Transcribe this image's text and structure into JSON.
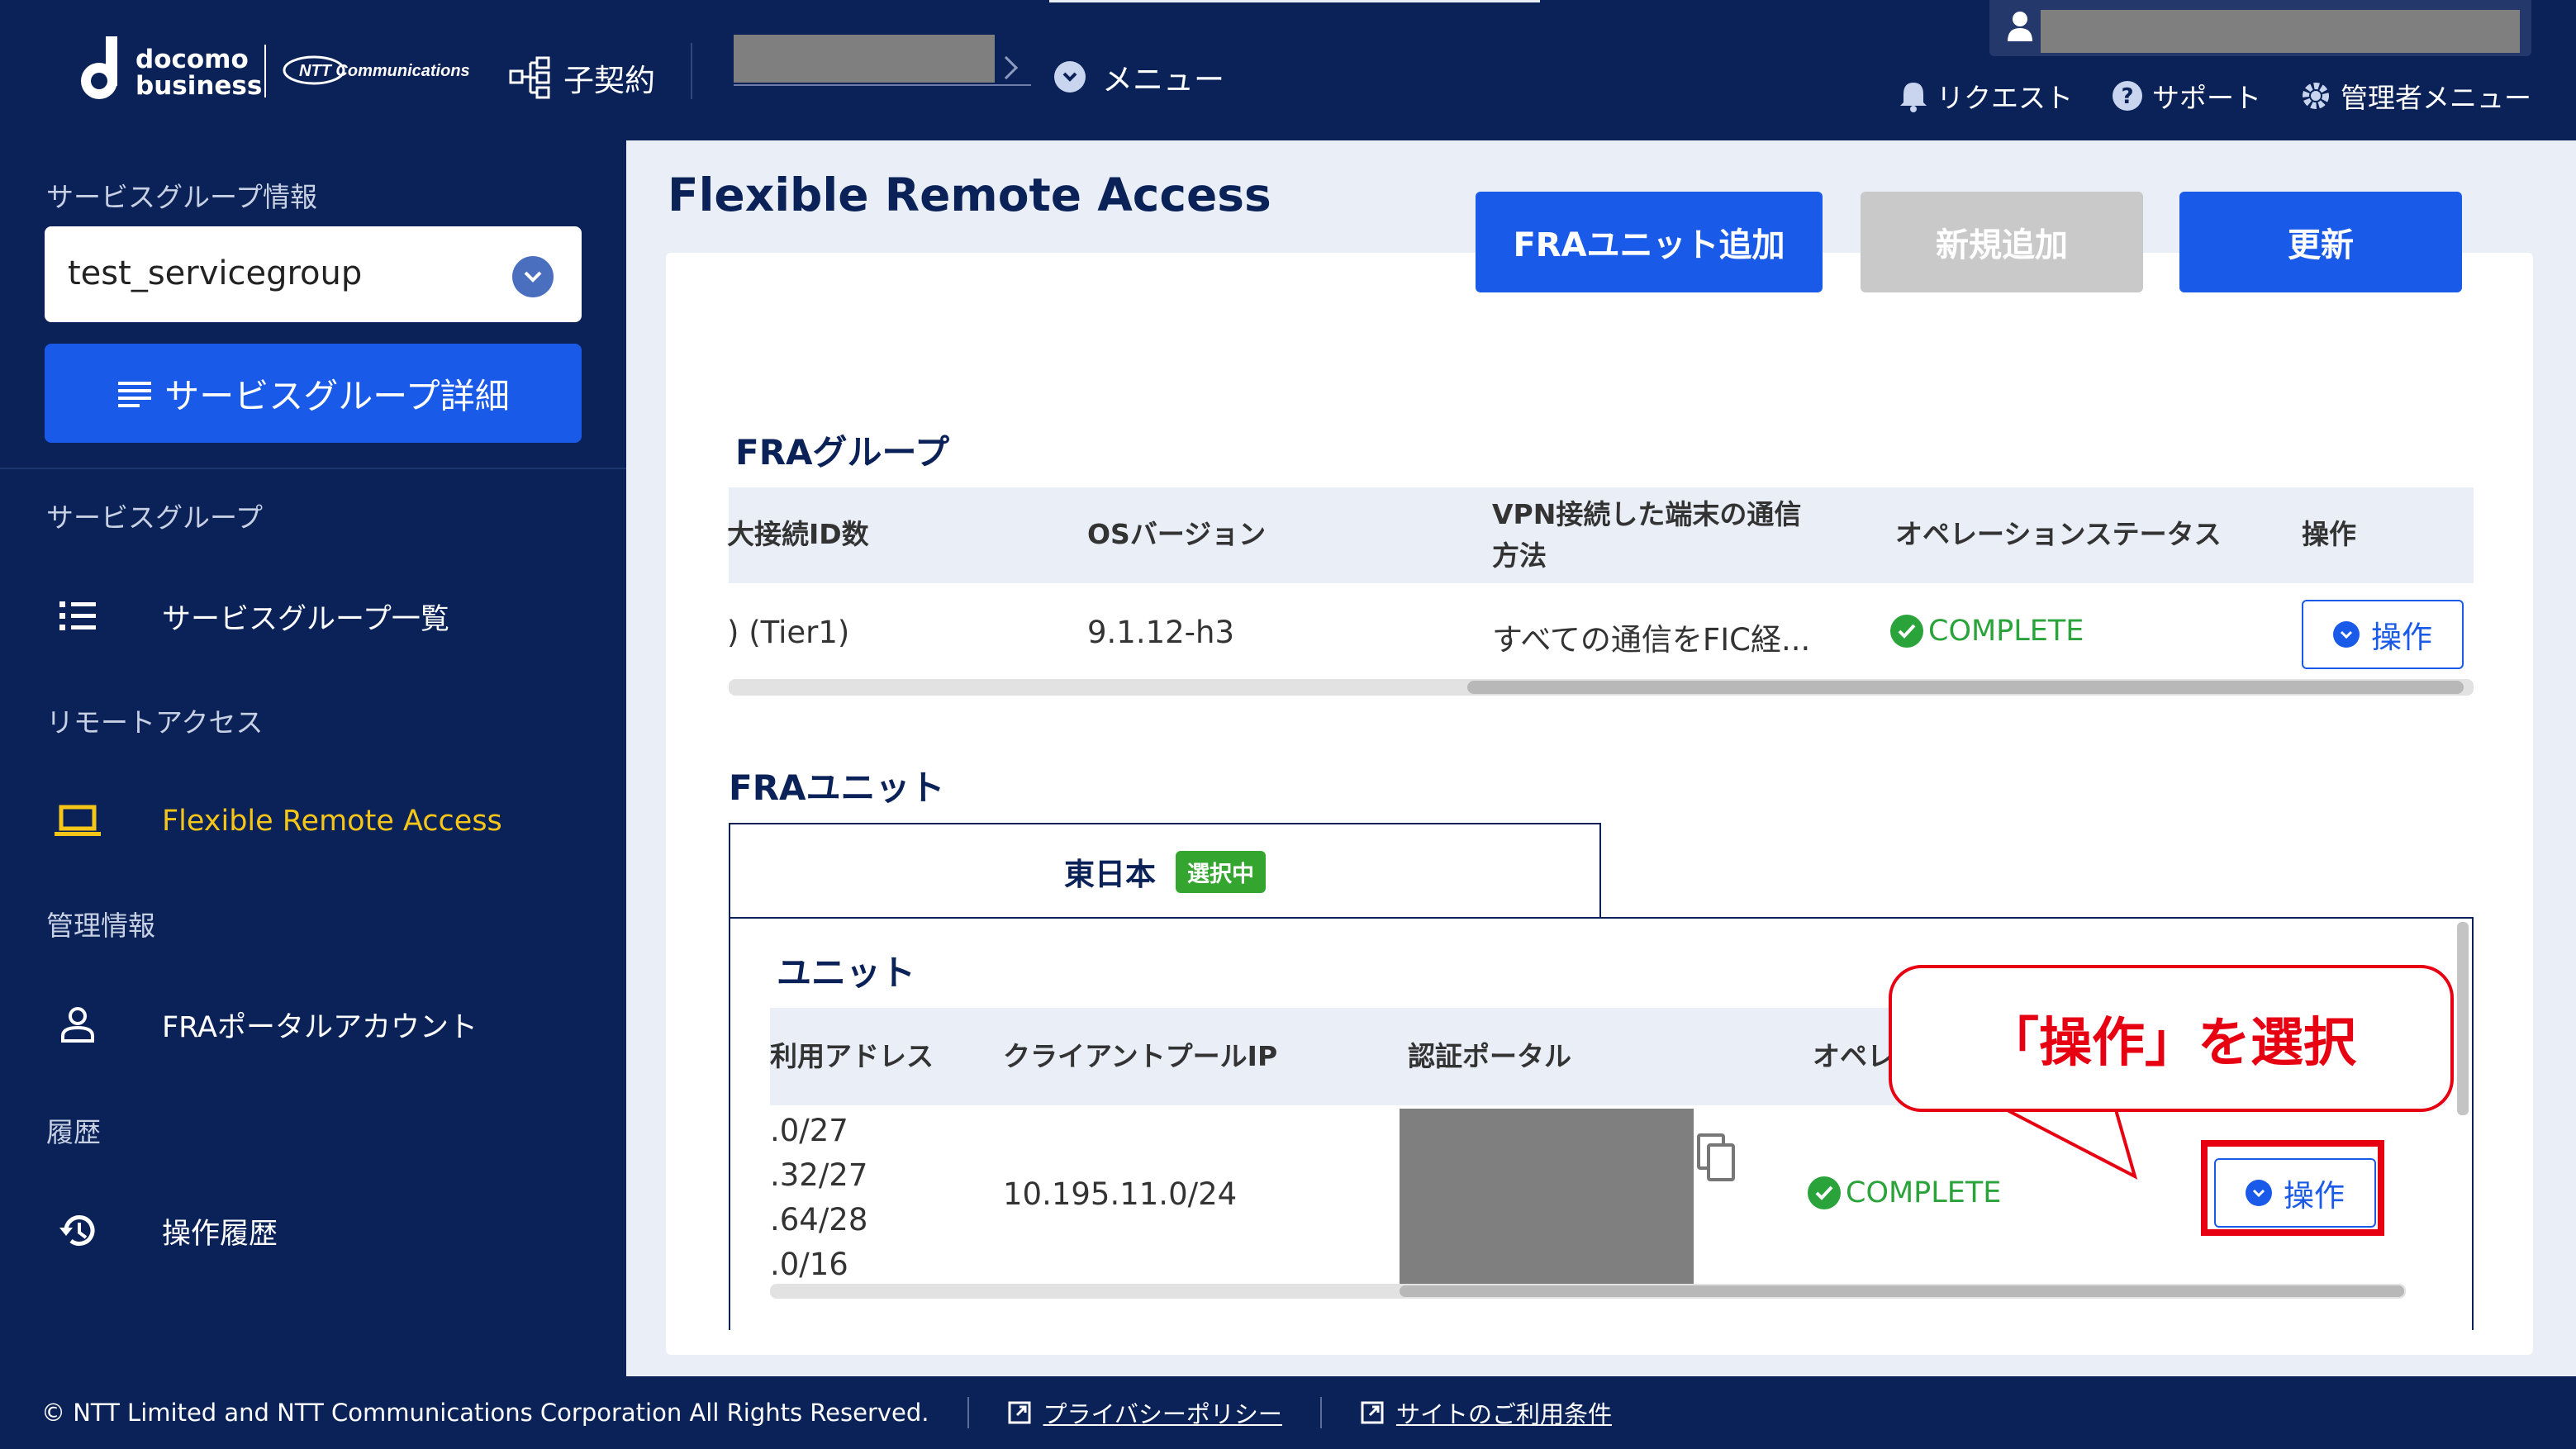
{
  "header": {
    "logo_docomo_line1": "docomo",
    "logo_docomo_line2": "business",
    "logo_ntt": "NTT Communications",
    "subcontract": "子契約",
    "menu": "メニュー",
    "links": [
      "リクエスト",
      "サポート",
      "管理者メニュー"
    ]
  },
  "sidebar": {
    "sg_info_label": "サービスグループ情報",
    "sg_select_value": "test_servicegroup",
    "sg_detail_button": "サービスグループ詳細",
    "sections": {
      "service_group": "サービスグループ",
      "remote_access": "リモートアクセス",
      "management": "管理情報",
      "history": "履歴"
    },
    "items": {
      "sg_list": "サービスグループ一覧",
      "fra": "Flexible Remote Access",
      "fra_portal": "FRAポータルアカウント",
      "op_history": "操作履歴"
    }
  },
  "main": {
    "title": "Flexible Remote Access",
    "buttons": {
      "add_unit": "FRAユニット追加",
      "add_new": "新規追加",
      "refresh": "更新"
    },
    "group": {
      "title": "FRAグループ",
      "headers": [
        "大接続ID数",
        "OSバージョン",
        "VPN接続した端末の通信",
        "方法",
        "オペレーションステータス",
        "操作"
      ],
      "row": {
        "conn_ids": ") (Tier1)",
        "os_version": "9.1.12-h3",
        "vpn_method": "すべての通信をFIC経...",
        "status": "COMPLETE",
        "op": "操作"
      }
    },
    "unit_section": {
      "title": "FRAユニット",
      "tab_label": "東日本",
      "tab_badge": "選択中",
      "subtitle": "ユニット",
      "headers": [
        "利用アドレス",
        "クライアントプールIP",
        "認証ポータル",
        "オペレ"
      ],
      "row": {
        "addresses": [
          ".0/27",
          ".32/27",
          ".64/28",
          ".0/16"
        ],
        "client_pool": "10.195.11.0/24",
        "status": "COMPLETE",
        "op": "操作"
      }
    },
    "callout": "「操作」を選択"
  },
  "footer": {
    "copyright": "© NTT Limited and NTT Communications Corporation All Rights Reserved.",
    "privacy": "プライバシーポリシー",
    "terms": "サイトのご利用条件"
  },
  "colors": {
    "navy": "#0b2258",
    "primary": "#1a5ae8",
    "active": "#f5c518",
    "success": "#2ba33b",
    "callout": "#e60012"
  }
}
